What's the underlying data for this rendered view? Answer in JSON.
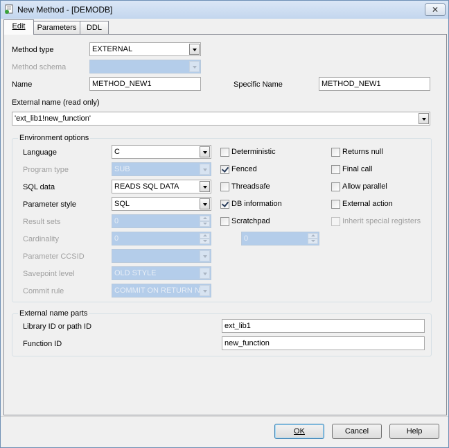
{
  "window": {
    "title": "New Method - [DEMODB]",
    "close_glyph": "✕"
  },
  "tabs": [
    {
      "label": "Edit",
      "active": true
    },
    {
      "label": "Parameters",
      "active": false
    },
    {
      "label": "DDL",
      "active": false
    }
  ],
  "method": {
    "type_label": "Method type",
    "type_value": "EXTERNAL",
    "schema_label": "Method schema",
    "schema_value": "",
    "name_label": "Name",
    "name_value": "METHOD_NEW1",
    "specific_label": "Specific Name",
    "specific_value": "METHOD_NEW1",
    "external_label": "External name (read only)",
    "external_value": "'ext_lib1!new_function'"
  },
  "env": {
    "title": "Environment options",
    "language_label": "Language",
    "language_value": "C",
    "program_type_label": "Program type",
    "program_type_value": "SUB",
    "sql_data_label": "SQL data",
    "sql_data_value": "READS SQL DATA",
    "param_style_label": "Parameter style",
    "param_style_value": "SQL",
    "result_sets_label": "Result sets",
    "result_sets_value": "0",
    "cardinality_label": "Cardinality",
    "cardinality_value": "0",
    "ccsid_label": "Parameter CCSID",
    "ccsid_value": "",
    "savepoint_label": "Savepoint level",
    "savepoint_value": "OLD STYLE",
    "commit_label": "Commit rule",
    "commit_value": "COMMIT ON RETURN N",
    "scratchpad_value": "0",
    "checks": {
      "deterministic": {
        "label": "Deterministic",
        "checked": false
      },
      "fenced": {
        "label": "Fenced",
        "checked": true
      },
      "threadsafe": {
        "label": "Threadsafe",
        "checked": false
      },
      "db_information": {
        "label": "DB information",
        "checked": true
      },
      "scratchpad": {
        "label": "Scratchpad",
        "checked": false
      },
      "returns_null": {
        "label": "Returns null",
        "checked": false
      },
      "final_call": {
        "label": "Final call",
        "checked": false
      },
      "allow_parallel": {
        "label": "Allow parallel",
        "checked": false
      },
      "external_action": {
        "label": "External action",
        "checked": false
      },
      "inherit_special": {
        "label": "Inherit special registers",
        "checked": false
      }
    }
  },
  "parts": {
    "title": "External name parts",
    "library_label": "Library ID or path ID",
    "library_value": "ext_lib1",
    "function_label": "Function ID",
    "function_value": "new_function"
  },
  "buttons": {
    "ok": "OK",
    "cancel": "Cancel",
    "help": "Help"
  }
}
